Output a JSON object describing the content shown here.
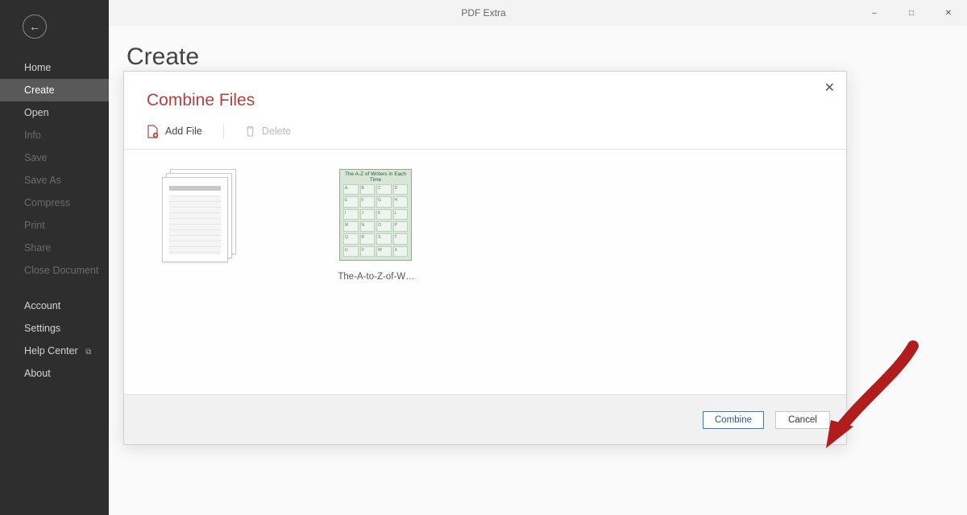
{
  "app_title": "PDF Extra",
  "window_controls": {
    "min": "–",
    "max": "□",
    "close": "✕"
  },
  "sidebar": {
    "items": [
      {
        "label": "Home",
        "state": "normal"
      },
      {
        "label": "Create",
        "state": "active"
      },
      {
        "label": "Open",
        "state": "normal"
      },
      {
        "label": "Info",
        "state": "disabled"
      },
      {
        "label": "Save",
        "state": "disabled"
      },
      {
        "label": "Save As",
        "state": "disabled"
      },
      {
        "label": "Compress",
        "state": "disabled"
      },
      {
        "label": "Print",
        "state": "disabled"
      },
      {
        "label": "Share",
        "state": "disabled"
      },
      {
        "label": "Close Document",
        "state": "disabled"
      }
    ],
    "lower": [
      {
        "label": "Account"
      },
      {
        "label": "Settings"
      },
      {
        "label": "Help Center",
        "external": true
      },
      {
        "label": "About"
      }
    ]
  },
  "page_title": "Create",
  "dialog": {
    "title": "Combine Files",
    "toolbar": {
      "add_file": "Add File",
      "delete": "Delete"
    },
    "files": [
      {
        "name": "",
        "kind": "stack"
      },
      {
        "name": "The-A-to-Z-of-W…",
        "kind": "poster",
        "poster_title": "The A-Z of\nWriters in Each Time"
      }
    ],
    "buttons": {
      "combine": "Combine",
      "cancel": "Cancel"
    }
  }
}
